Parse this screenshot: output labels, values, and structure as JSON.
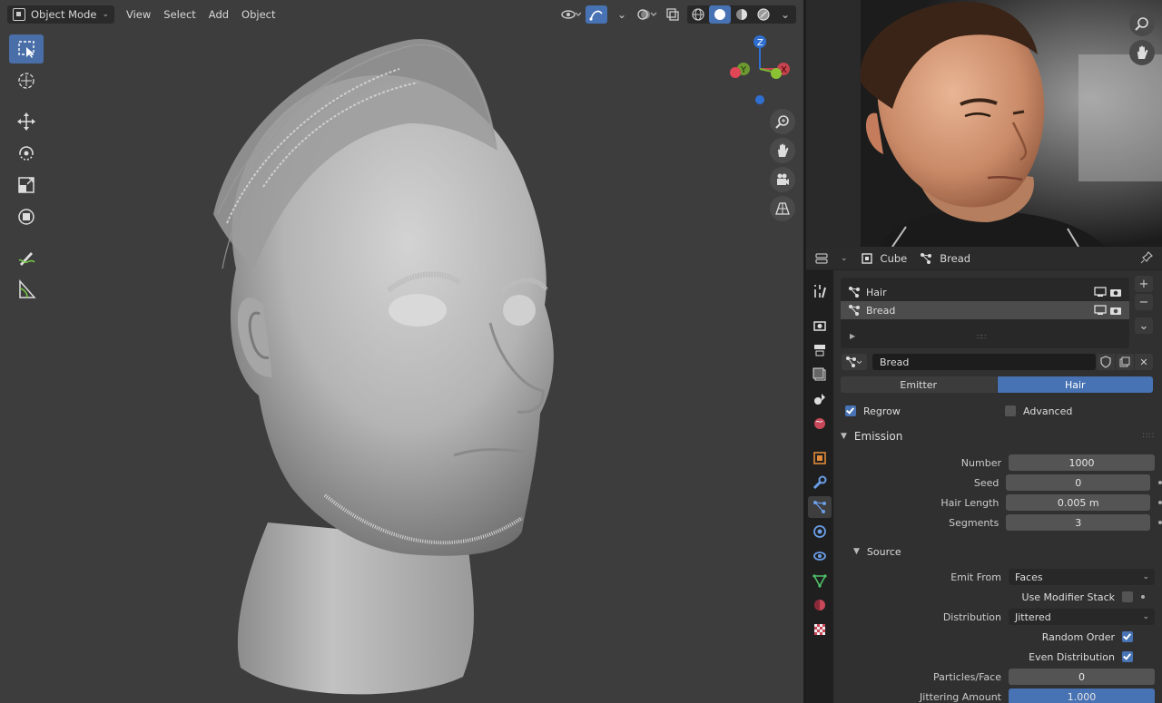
{
  "viewport": {
    "mode_label": "Object Mode",
    "menus": [
      "View",
      "Select",
      "Add",
      "Object"
    ],
    "gizmo": {
      "x": "X",
      "y": "Y",
      "z": "Z"
    }
  },
  "properties": {
    "header": {
      "object": "Cube",
      "data": "Bread"
    },
    "particle_systems": [
      {
        "name": "Hair",
        "selected": false
      },
      {
        "name": "Bread",
        "selected": true
      }
    ],
    "settings_name": "Bread",
    "type_options": [
      "Emitter",
      "Hair"
    ],
    "type_selected": "Hair",
    "regrow_label": "Regrow",
    "regrow_checked": true,
    "advanced_label": "Advanced",
    "advanced_checked": false,
    "emission": {
      "title": "Emission",
      "number_label": "Number",
      "number_value": "1000",
      "seed_label": "Seed",
      "seed_value": "0",
      "hair_length_label": "Hair Length",
      "hair_length_value": "0.005 m",
      "segments_label": "Segments",
      "segments_value": "3"
    },
    "source": {
      "title": "Source",
      "emit_from_label": "Emit From",
      "emit_from_value": "Faces",
      "use_modifier_stack_label": "Use Modifier Stack",
      "use_modifier_stack_checked": false,
      "distribution_label": "Distribution",
      "distribution_value": "Jittered",
      "random_order_label": "Random Order",
      "random_order_checked": true,
      "even_distribution_label": "Even Distribution",
      "even_distribution_checked": true,
      "particles_face_label": "Particles/Face",
      "particles_face_value": "0",
      "jittering_label": "Jittering Amount",
      "jittering_value": "1.000",
      "jittering_fill": 1.0
    }
  },
  "colors": {
    "accent": "#4772b3",
    "viewport_bg": "#3d3d3d",
    "panel_bg": "#303030"
  }
}
